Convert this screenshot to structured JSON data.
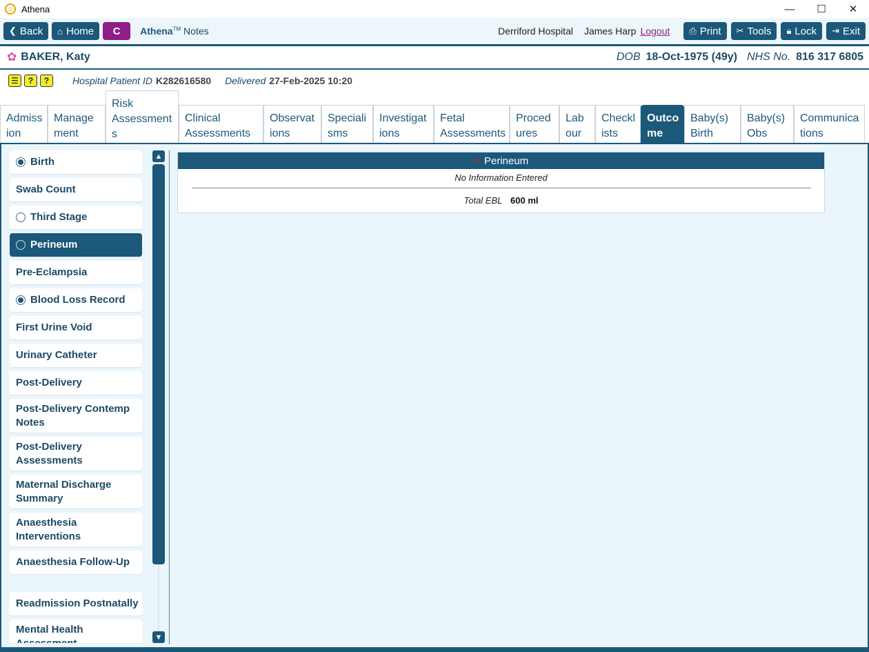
{
  "window": {
    "title": "Athena",
    "minimize": "—",
    "maximize": "☐",
    "close": "✕"
  },
  "toolbar": {
    "back": "Back",
    "home": "Home",
    "c_label": "C",
    "brand": "Athena",
    "brand_tm": "TM",
    "brand_suffix": " Notes",
    "hospital": "Derriford Hospital",
    "user": "James Harp",
    "logout": "Logout",
    "print": "Print",
    "tools": "Tools",
    "lock": "Lock",
    "exit": "Exit"
  },
  "patient": {
    "name": "BAKER, Katy",
    "dob_label": "DOB",
    "dob": "18-Oct-1975 (49y)",
    "nhs_label": "NHS No.",
    "nhs": "816 317 6805",
    "hospital_id_label": "Hospital Patient ID",
    "hospital_id": "K282616580",
    "delivered_label": "Delivered",
    "delivered": "27-Feb-2025 10:20",
    "alerts": [
      "☰",
      "?",
      "?"
    ]
  },
  "tabs": [
    {
      "label": "Admiss\nion"
    },
    {
      "label": "Manage\nment"
    },
    {
      "label": "Risk\nAssessment\ns"
    },
    {
      "label": "Clinical\nAssessments"
    },
    {
      "label": "Observat\nions"
    },
    {
      "label": "Speciali\nsms"
    },
    {
      "label": "Investigat\nions"
    },
    {
      "label": "Fetal\nAssessments"
    },
    {
      "label": "Proced\nures"
    },
    {
      "label": "Lab\nour"
    },
    {
      "label": "Checkl\nists"
    },
    {
      "label": "Outco\nme"
    },
    {
      "label": "Baby(s)\nBirth"
    },
    {
      "label": "Baby(s)\nObs"
    },
    {
      "label": "Communica\ntions"
    }
  ],
  "menu": [
    {
      "label": "Birth"
    },
    {
      "label": "Swab Count"
    },
    {
      "label": "Third Stage"
    },
    {
      "label": "Perineum"
    },
    {
      "label": "Pre-Eclampsia"
    },
    {
      "label": "Blood Loss Record"
    },
    {
      "label": "First Urine Void"
    },
    {
      "label": "Urinary Catheter"
    },
    {
      "label": "Post-Delivery"
    },
    {
      "label": "Post-Delivery Contemp Notes"
    },
    {
      "label": "Post-Delivery Assessments"
    },
    {
      "label": "Maternal Discharge Summary"
    },
    {
      "label": "Anaesthesia Interventions"
    },
    {
      "label": "Anaesthesia Follow-Up"
    },
    {
      "label": "Readmission Postnatally"
    },
    {
      "label": "Mental Health Assessment"
    }
  ],
  "panel": {
    "title": "Perineum",
    "no_info": "No Information Entered",
    "ebl_label": "Total EBL",
    "ebl_value": "600 ml"
  },
  "colors": {
    "primary": "#1b587a",
    "accent": "#8e1f86",
    "background": "#ebf6fc"
  }
}
